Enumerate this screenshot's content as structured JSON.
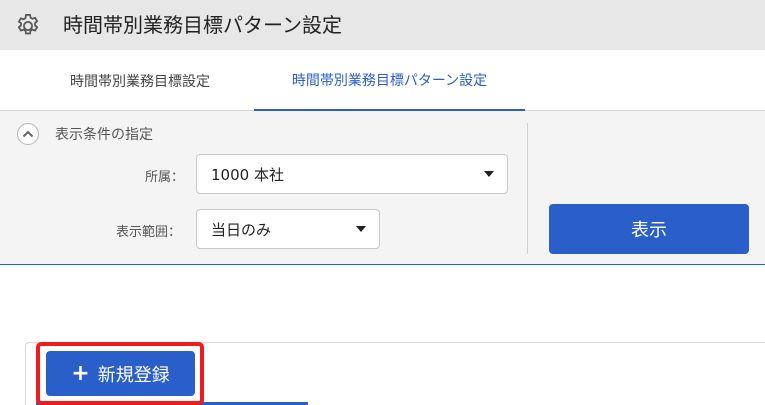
{
  "header": {
    "title": "時間帯別業務目標パターン設定",
    "icon": "gear-icon"
  },
  "tabs": [
    {
      "label": "時間帯別業務目標設定",
      "active": false
    },
    {
      "label": "時間帯別業務目標パターン設定",
      "active": true
    }
  ],
  "conditions": {
    "title": "表示条件の指定",
    "affiliation_label": "所属：",
    "affiliation_value": "1000 本社",
    "range_label": "表示範囲：",
    "range_value": "当日のみ",
    "show_button": "表示"
  },
  "actions": {
    "new_button": "新規登録",
    "new_button_icon": "plus-icon"
  },
  "colors": {
    "accent": "#2a5ec8",
    "highlight": "#ee1c1c",
    "header_bg": "#e7e7e7"
  }
}
